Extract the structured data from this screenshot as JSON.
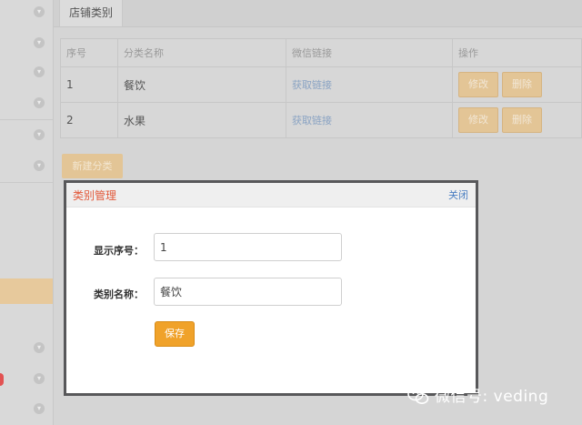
{
  "tab": {
    "label": "店铺类别"
  },
  "table": {
    "headers": [
      "序号",
      "分类名称",
      "微信链接",
      "操作"
    ],
    "rows": [
      {
        "index": "1",
        "name": "餐饮",
        "link": "获取链接",
        "edit": "修改",
        "delete": "删除"
      },
      {
        "index": "2",
        "name": "水果",
        "link": "获取链接",
        "edit": "修改",
        "delete": "删除"
      }
    ]
  },
  "new_category_label": "新建分类",
  "modal": {
    "title": "类别管理",
    "close_label": "关闭",
    "order_label": "显示序号：",
    "order_value": "1",
    "name_label": "类别名称：",
    "name_value": "餐饮",
    "save_label": "保存"
  },
  "watermark": {
    "text": "微信号: veding"
  },
  "colors": {
    "accent": "#f0a22a",
    "modal_title": "#e2593a",
    "link": "#4a7ec2",
    "button_dim": "#e3c596"
  }
}
